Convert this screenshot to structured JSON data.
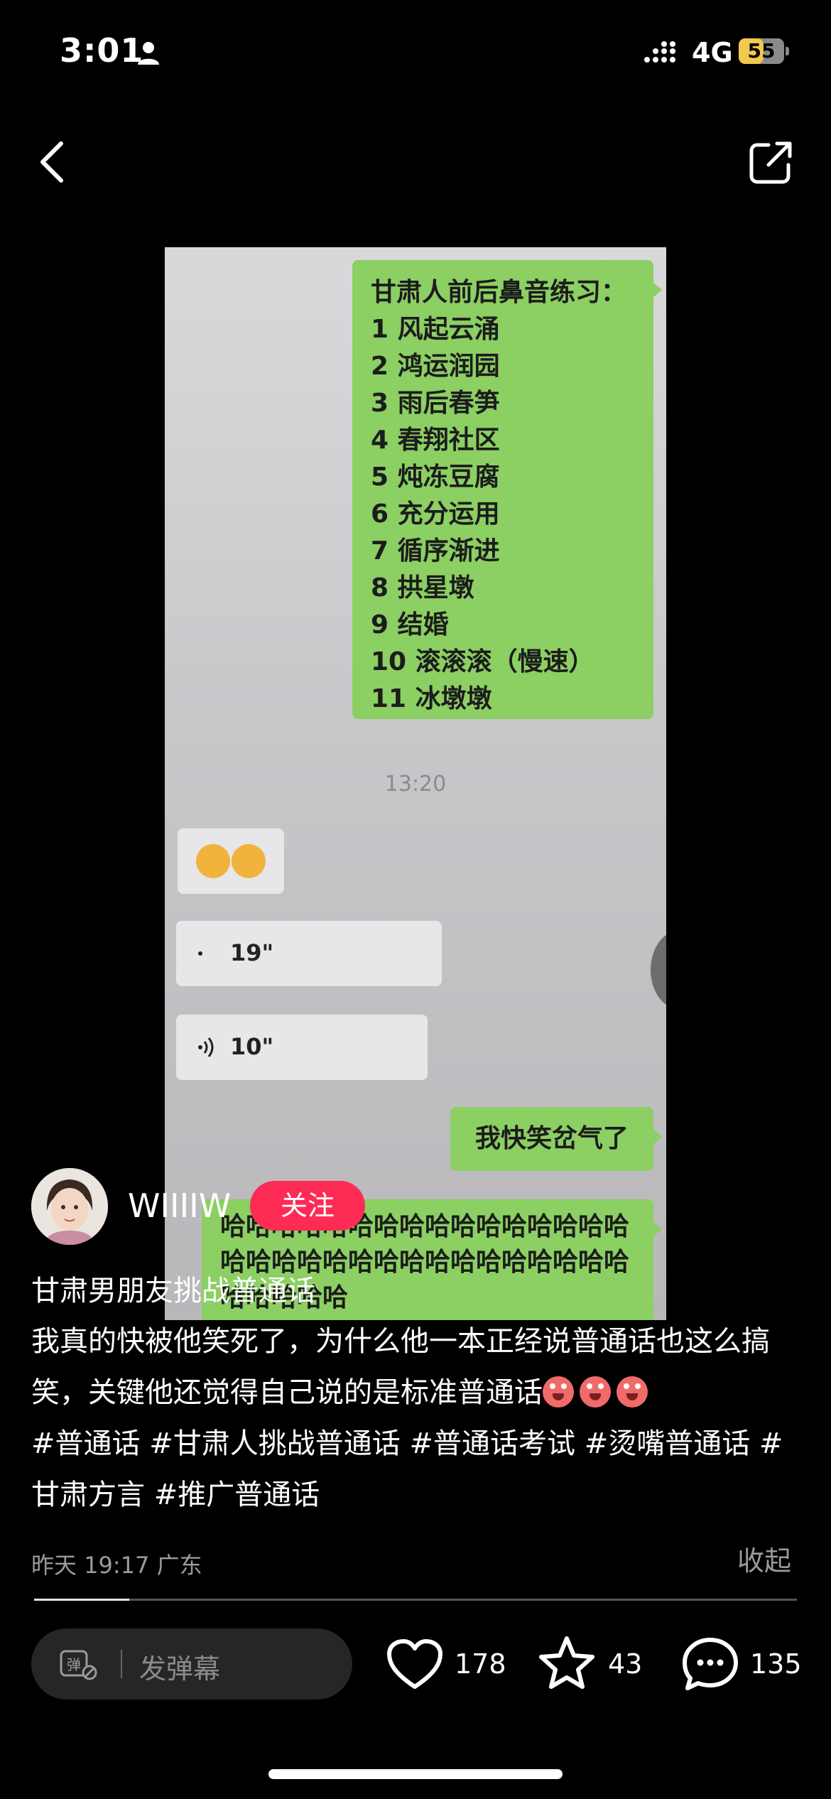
{
  "status_bar": {
    "time": "3:01",
    "network": "4G",
    "battery": "55",
    "battery_level": 55
  },
  "chat_image": {
    "list_title": "甘肃人前后鼻音练习：",
    "list_items": [
      "1 风起云涌",
      "2 鸿运润园",
      "3 雨后春笋",
      "4 春翔社区",
      "5 炖冻豆腐",
      "6 充分运用",
      "7 循序渐进",
      "8 拱星墩",
      "9 结婚",
      "10 滚滚滚（慢速）",
      "11 冰墩墩"
    ],
    "timestamp": "13:20",
    "voice_1": "19\"",
    "voice_2": "10\"",
    "reply_short": "我快笑岔气了",
    "reply_long": "哈哈哈哈哈哈哈哈哈哈哈哈哈哈哈哈哈哈哈哈哈哈哈哈哈哈哈哈哈哈哈哈哈哈哈哈哈"
  },
  "user": {
    "name": "WIIIIW",
    "follow_label": "关注"
  },
  "caption": {
    "title": "甘肃男朋友挑战普通话",
    "body": "我真的快被他笑死了，为什么他一本正经说普通话也这么搞笑，关键他还觉得自己说的是标准普通话",
    "hashtags": "#普通话  #甘肃人挑战普通话  #普通话考试  #烫嘴普通话  #甘肃方言  #推广普通话"
  },
  "meta": {
    "date_location": "昨天 19:17 广东",
    "collapse_label": "收起"
  },
  "progress": {
    "fraction": 0.125
  },
  "bottom_bar": {
    "danmu_icon_label": "弹",
    "danmu_placeholder": "发弹幕",
    "likes": "178",
    "favorites": "43",
    "comments": "135"
  },
  "colors": {
    "follow": "#fe2c55",
    "chat_green": "#8ccf63",
    "battery": "#f2c94c"
  }
}
